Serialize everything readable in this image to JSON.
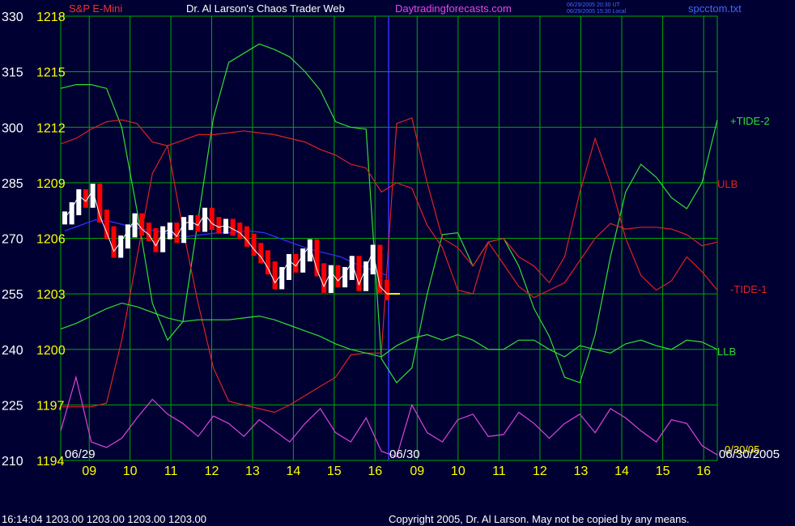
{
  "header": {
    "symbol": "S&P E-Mini",
    "title": "Dr. Al Larson's Chaos Trader Web",
    "site": "Daytradingforecasts.com",
    "timestamp_line1": "06/29/2005 20:30 UT",
    "timestamp_line2": "06/29/2005 15:30 Local",
    "filename": "spcctom.txt"
  },
  "footer": {
    "quote_line": "16:14:04  1203.00 1203.00 1203.00 1203.00",
    "copyright": "Copyright 2005, Dr. Al Larson. May not be copied by any means."
  },
  "colors": {
    "background": "#000033",
    "grid": "#00aa00",
    "price_text": "#ffff00",
    "tide2": "#33dd33",
    "ulb": "#dd2222",
    "tide1": "#dd2222",
    "llb": "#33dd33",
    "cycle": "#dd44dd",
    "price_up": "#ffffff",
    "price_down": "#ff0000",
    "average": "#3333ff",
    "divider": "#3333ff"
  },
  "chart_data": {
    "type": "line",
    "x_ticks": [
      "09",
      "10",
      "11",
      "12",
      "13",
      "14",
      "15",
      "16",
      "09",
      "10",
      "11",
      "12",
      "13",
      "14",
      "15",
      "16"
    ],
    "date_labels": [
      "06/29",
      "06/30",
      "06/30/2005"
    ],
    "y_left_ticks": [
      "330",
      "315",
      "300",
      "285",
      "270",
      "255",
      "240",
      "225",
      "210"
    ],
    "y_price_ticks": [
      "1218",
      "1215",
      "1212",
      "1209",
      "1206",
      "1203",
      "1200",
      "1197",
      "1194"
    ],
    "ylim_price": [
      1194,
      1218
    ],
    "grid": true,
    "series_labels": {
      "tide2": "+TIDE-2",
      "ulb": "ULB",
      "tide1": "-TIDE-1",
      "llb": "LLB",
      "current": "0/30/05"
    },
    "last_price": 1203.0,
    "series": [
      {
        "key": "tide2",
        "values": [
          1214.1,
          1214.3,
          1214.3,
          1214.1,
          1212.0,
          1207.5,
          1202.5,
          1200.5,
          1201.5,
          1207.0,
          1212.5,
          1215.5,
          1216.0,
          1216.5,
          1216.2,
          1215.8,
          1215.0,
          1214.0,
          1212.3,
          1212.0,
          1211.9,
          1199.5,
          1198.2,
          1199.0,
          1203.0,
          1206.2,
          1206.3,
          1204.5,
          1205.8,
          1206.0,
          1204.5,
          1202.2,
          1200.7,
          1198.5,
          1198.2,
          1200.8,
          1205.0,
          1208.5,
          1210.0,
          1209.3,
          1208.2,
          1207.6,
          1209.0,
          1212.4
        ]
      },
      {
        "key": "ulb",
        "values": [
          1211.1,
          1211.4,
          1211.9,
          1212.3,
          1212.4,
          1212.2,
          1211.2,
          1211.0,
          1211.3,
          1211.6,
          1211.6,
          1211.7,
          1211.8,
          1211.7,
          1211.6,
          1211.4,
          1211.2,
          1210.8,
          1210.5,
          1210.0,
          1209.8,
          1208.5,
          1209.0,
          1208.7,
          1206.7,
          1205.5,
          1203.2,
          1203.0,
          1205.8,
          1204.6,
          1203.4,
          1202.8,
          1203.2,
          1203.6,
          1204.8,
          1206.0,
          1206.8,
          1206.5,
          1206.6,
          1206.6,
          1206.5,
          1206.2,
          1205.6,
          1205.8
        ]
      },
      {
        "key": "tide1",
        "values": [
          1196.9,
          1196.9,
          1196.9,
          1197.1,
          1200.5,
          1205.0,
          1209.5,
          1211.0,
          1206.5,
          1202.5,
          1199.0,
          1197.2,
          1197.0,
          1196.8,
          1196.6,
          1197.0,
          1197.5,
          1198.0,
          1198.5,
          1199.7,
          1199.8,
          1199.8,
          1212.2,
          1212.5,
          1209.0,
          1206.0,
          1205.5,
          1204.5,
          1205.8,
          1206.0,
          1205.0,
          1204.5,
          1203.6,
          1205.0,
          1208.5,
          1211.4,
          1209.0,
          1206.0,
          1204.0,
          1203.2,
          1203.7,
          1205.0,
          1204.2,
          1203.2
        ]
      },
      {
        "key": "llb",
        "values": [
          1201.1,
          1201.4,
          1201.8,
          1202.2,
          1202.5,
          1202.3,
          1202.0,
          1201.7,
          1201.5,
          1201.6,
          1201.6,
          1201.6,
          1201.7,
          1201.8,
          1201.6,
          1201.3,
          1201.0,
          1200.7,
          1200.3,
          1200.0,
          1199.8,
          1199.6,
          1200.2,
          1200.6,
          1200.8,
          1200.5,
          1200.8,
          1200.5,
          1200.0,
          1200.0,
          1200.5,
          1200.5,
          1200.0,
          1199.6,
          1200.2,
          1200.0,
          1199.8,
          1200.3,
          1200.5,
          1200.2,
          1200.0,
          1200.5,
          1200.4,
          1200.0
        ]
      },
      {
        "key": "cycle",
        "values": [
          1195.6,
          1198.5,
          1195.0,
          1194.7,
          1195.2,
          1196.3,
          1197.3,
          1196.5,
          1196.0,
          1195.3,
          1196.4,
          1196.0,
          1195.3,
          1196.2,
          1195.6,
          1195.0,
          1196.0,
          1196.8,
          1195.5,
          1195.0,
          1196.3,
          1194.5,
          1194.2,
          1197.0,
          1195.5,
          1195.0,
          1196.2,
          1196.5,
          1195.3,
          1195.4,
          1196.6,
          1196.0,
          1195.2,
          1196.0,
          1196.5,
          1195.5,
          1196.8,
          1196.3,
          1195.6,
          1195.0,
          1196.2,
          1196.0,
          1194.8,
          1194.3
        ]
      },
      {
        "key": "price",
        "values": [
          1207.1,
          1207.6,
          1208.3,
          1208.0,
          1208.6,
          1207.2,
          1206.3,
          1205.3,
          1205.8,
          1206.4,
          1207.0,
          1206.5,
          1206.2,
          1205.6,
          1206.3,
          1206.5,
          1206.1,
          1206.8,
          1206.9,
          1206.7,
          1207.3,
          1206.8,
          1206.6,
          1206.7,
          1206.5,
          1206.3,
          1205.9,
          1205.4,
          1205.0,
          1204.4,
          1203.6,
          1204.1,
          1204.8,
          1204.5,
          1205.1,
          1205.6,
          1204.3,
          1203.4,
          1204.2,
          1203.7,
          1204.1,
          1204.7,
          1203.5,
          1204.4,
          1205.3,
          1203.4,
          1203.0
        ]
      },
      {
        "key": "average",
        "values": [
          1206.4,
          1206.7,
          1207.0,
          1206.9,
          1206.7,
          1206.5,
          1206.4,
          1206.2,
          1206.1,
          1206.2,
          1206.3,
          1206.3,
          1206.4,
          1206.3,
          1206.0,
          1205.7,
          1205.4,
          1205.2,
          1205.0,
          1204.6,
          1204.3,
          1204.0
        ]
      }
    ]
  }
}
